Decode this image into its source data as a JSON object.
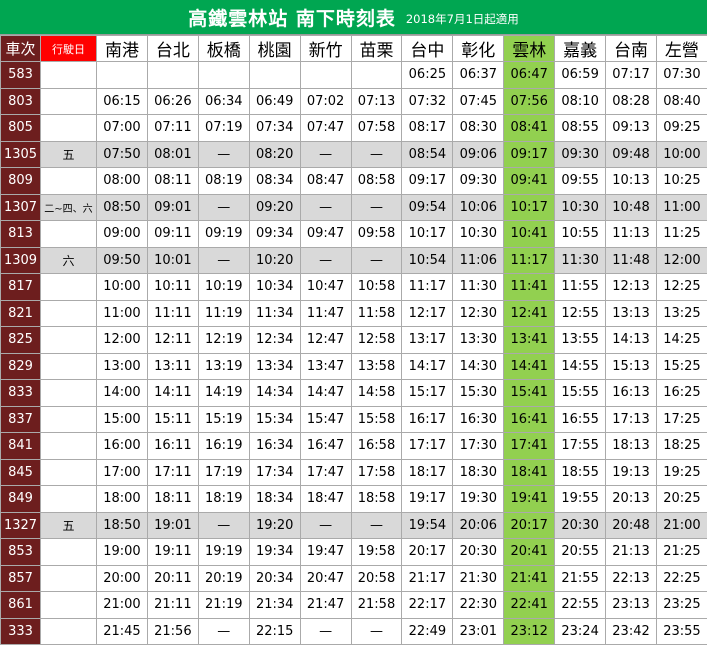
{
  "title": "高鐵雲林站 南下時刻表",
  "subtitle": "2018年7月1日起適用",
  "columns": {
    "train": "車次",
    "days": "行駛日",
    "stations": [
      "南港",
      "台北",
      "板橋",
      "桃園",
      "新竹",
      "苗栗",
      "台中",
      "彰化",
      "雲林",
      "嘉義",
      "台南",
      "左營"
    ]
  },
  "highlight_station_index": 8,
  "colors": {
    "title_bg": "#00a651",
    "train_col_bg": "#6d1e1e",
    "days_header_bg": "#ff0000",
    "highlight_bg": "#92d050",
    "alt_row_bg": "#d9d9d9"
  },
  "rows": [
    {
      "train": "583",
      "days": "",
      "alt": false,
      "times": [
        "",
        "",
        "",
        "",
        "",
        "",
        "06:25",
        "06:37",
        "06:47",
        "06:59",
        "07:17",
        "07:30"
      ]
    },
    {
      "train": "803",
      "days": "",
      "alt": false,
      "times": [
        "06:15",
        "06:26",
        "06:34",
        "06:49",
        "07:02",
        "07:13",
        "07:32",
        "07:45",
        "07:56",
        "08:10",
        "08:28",
        "08:40"
      ]
    },
    {
      "train": "805",
      "days": "",
      "alt": false,
      "times": [
        "07:00",
        "07:11",
        "07:19",
        "07:34",
        "07:47",
        "07:58",
        "08:17",
        "08:30",
        "08:41",
        "08:55",
        "09:13",
        "09:25"
      ]
    },
    {
      "train": "1305",
      "days": "五",
      "alt": true,
      "times": [
        "07:50",
        "08:01",
        "—",
        "08:20",
        "—",
        "—",
        "08:54",
        "09:06",
        "09:17",
        "09:30",
        "09:48",
        "10:00"
      ]
    },
    {
      "train": "809",
      "days": "",
      "alt": false,
      "times": [
        "08:00",
        "08:11",
        "08:19",
        "08:34",
        "08:47",
        "08:58",
        "09:17",
        "09:30",
        "09:41",
        "09:55",
        "10:13",
        "10:25"
      ]
    },
    {
      "train": "1307",
      "days": "二~四、六",
      "alt": true,
      "times": [
        "08:50",
        "09:01",
        "—",
        "09:20",
        "—",
        "—",
        "09:54",
        "10:06",
        "10:17",
        "10:30",
        "10:48",
        "11:00"
      ]
    },
    {
      "train": "813",
      "days": "",
      "alt": false,
      "times": [
        "09:00",
        "09:11",
        "09:19",
        "09:34",
        "09:47",
        "09:58",
        "10:17",
        "10:30",
        "10:41",
        "10:55",
        "11:13",
        "11:25"
      ]
    },
    {
      "train": "1309",
      "days": "六",
      "alt": true,
      "times": [
        "09:50",
        "10:01",
        "—",
        "10:20",
        "—",
        "—",
        "10:54",
        "11:06",
        "11:17",
        "11:30",
        "11:48",
        "12:00"
      ]
    },
    {
      "train": "817",
      "days": "",
      "alt": false,
      "times": [
        "10:00",
        "10:11",
        "10:19",
        "10:34",
        "10:47",
        "10:58",
        "11:17",
        "11:30",
        "11:41",
        "11:55",
        "12:13",
        "12:25"
      ]
    },
    {
      "train": "821",
      "days": "",
      "alt": false,
      "times": [
        "11:00",
        "11:11",
        "11:19",
        "11:34",
        "11:47",
        "11:58",
        "12:17",
        "12:30",
        "12:41",
        "12:55",
        "13:13",
        "13:25"
      ]
    },
    {
      "train": "825",
      "days": "",
      "alt": false,
      "times": [
        "12:00",
        "12:11",
        "12:19",
        "12:34",
        "12:47",
        "12:58",
        "13:17",
        "13:30",
        "13:41",
        "13:55",
        "14:13",
        "14:25"
      ]
    },
    {
      "train": "829",
      "days": "",
      "alt": false,
      "times": [
        "13:00",
        "13:11",
        "13:19",
        "13:34",
        "13:47",
        "13:58",
        "14:17",
        "14:30",
        "14:41",
        "14:55",
        "15:13",
        "15:25"
      ]
    },
    {
      "train": "833",
      "days": "",
      "alt": false,
      "times": [
        "14:00",
        "14:11",
        "14:19",
        "14:34",
        "14:47",
        "14:58",
        "15:17",
        "15:30",
        "15:41",
        "15:55",
        "16:13",
        "16:25"
      ]
    },
    {
      "train": "837",
      "days": "",
      "alt": false,
      "times": [
        "15:00",
        "15:11",
        "15:19",
        "15:34",
        "15:47",
        "15:58",
        "16:17",
        "16:30",
        "16:41",
        "16:55",
        "17:13",
        "17:25"
      ]
    },
    {
      "train": "841",
      "days": "",
      "alt": false,
      "times": [
        "16:00",
        "16:11",
        "16:19",
        "16:34",
        "16:47",
        "16:58",
        "17:17",
        "17:30",
        "17:41",
        "17:55",
        "18:13",
        "18:25"
      ]
    },
    {
      "train": "845",
      "days": "",
      "alt": false,
      "times": [
        "17:00",
        "17:11",
        "17:19",
        "17:34",
        "17:47",
        "17:58",
        "18:17",
        "18:30",
        "18:41",
        "18:55",
        "19:13",
        "19:25"
      ]
    },
    {
      "train": "849",
      "days": "",
      "alt": false,
      "times": [
        "18:00",
        "18:11",
        "18:19",
        "18:34",
        "18:47",
        "18:58",
        "19:17",
        "19:30",
        "19:41",
        "19:55",
        "20:13",
        "20:25"
      ]
    },
    {
      "train": "1327",
      "days": "五",
      "alt": true,
      "times": [
        "18:50",
        "19:01",
        "—",
        "19:20",
        "—",
        "—",
        "19:54",
        "20:06",
        "20:17",
        "20:30",
        "20:48",
        "21:00"
      ]
    },
    {
      "train": "853",
      "days": "",
      "alt": false,
      "times": [
        "19:00",
        "19:11",
        "19:19",
        "19:34",
        "19:47",
        "19:58",
        "20:17",
        "20:30",
        "20:41",
        "20:55",
        "21:13",
        "21:25"
      ]
    },
    {
      "train": "857",
      "days": "",
      "alt": false,
      "times": [
        "20:00",
        "20:11",
        "20:19",
        "20:34",
        "20:47",
        "20:58",
        "21:17",
        "21:30",
        "21:41",
        "21:55",
        "22:13",
        "22:25"
      ]
    },
    {
      "train": "861",
      "days": "",
      "alt": false,
      "times": [
        "21:00",
        "21:11",
        "21:19",
        "21:34",
        "21:47",
        "21:58",
        "22:17",
        "22:30",
        "22:41",
        "22:55",
        "23:13",
        "23:25"
      ]
    },
    {
      "train": "333",
      "days": "",
      "alt": false,
      "times": [
        "21:45",
        "21:56",
        "—",
        "22:15",
        "—",
        "—",
        "22:49",
        "23:01",
        "23:12",
        "23:24",
        "23:42",
        "23:55"
      ]
    }
  ]
}
